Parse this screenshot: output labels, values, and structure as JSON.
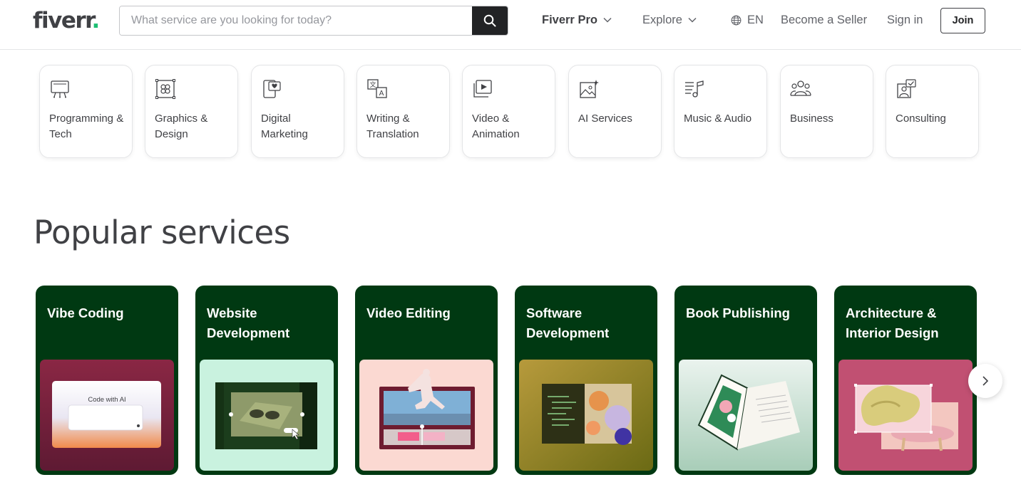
{
  "header": {
    "logo_text": "fiverr",
    "logo_dot": ".",
    "search_placeholder": "What service are you looking for today?",
    "nav": {
      "fiverr_pro": "Fiverr Pro",
      "explore": "Explore",
      "language": "EN",
      "become_seller": "Become a Seller",
      "sign_in": "Sign in",
      "join": "Join"
    }
  },
  "categories": [
    {
      "label": "Programming & Tech",
      "icon": "monitor-icon"
    },
    {
      "label": "Graphics & Design",
      "icon": "design-frame-icon"
    },
    {
      "label": "Digital Marketing",
      "icon": "phone-heart-icon"
    },
    {
      "label": "Writing & Translation",
      "icon": "translate-icon"
    },
    {
      "label": "Video & Animation",
      "icon": "video-play-icon"
    },
    {
      "label": "AI Services",
      "icon": "ai-image-icon"
    },
    {
      "label": "Music & Audio",
      "icon": "music-note-icon"
    },
    {
      "label": "Business",
      "icon": "people-icon"
    },
    {
      "label": "Consulting",
      "icon": "consulting-icon"
    }
  ],
  "popular": {
    "title": "Popular services",
    "services": [
      {
        "title": "Vibe Coding",
        "image_text": "Code with AI"
      },
      {
        "title": "Website Development"
      },
      {
        "title": "Video Editing"
      },
      {
        "title": "Software Development"
      },
      {
        "title": "Book Publishing"
      },
      {
        "title": "Architecture & Interior Design"
      }
    ]
  },
  "colors": {
    "card_green": "#003912",
    "brand_green": "#1dbf73",
    "text": "#404145"
  }
}
